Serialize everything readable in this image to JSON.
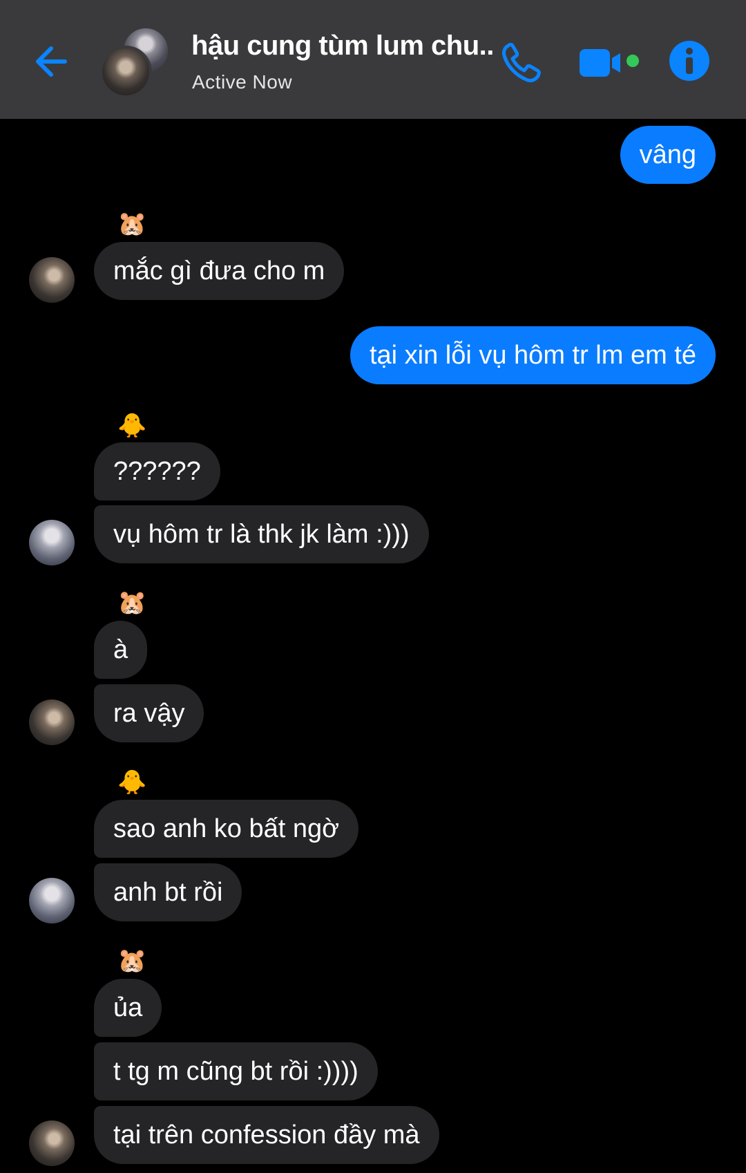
{
  "header": {
    "title": "hậu cung tùm lum chu...",
    "status": "Active Now",
    "colors": {
      "background": "#3a3a3c",
      "accent": "#0a84ff",
      "online_dot": "#34c759"
    },
    "icons": [
      "back-arrow-icon",
      "phone-icon",
      "video-camera-icon",
      "info-icon"
    ]
  },
  "messages": [
    {
      "direction": "outgoing",
      "text": "vâng"
    },
    {
      "direction": "incoming",
      "text": "mắc gì đưa cho m",
      "sender": "hamster"
    },
    {
      "direction": "outgoing",
      "text": "tại xin lỗi vụ hôm tr lm em té"
    },
    {
      "direction": "incoming",
      "text": "??????",
      "sender": "chick"
    },
    {
      "direction": "incoming",
      "text": "vụ hôm tr là thk jk làm :)))",
      "sender": "chick"
    },
    {
      "direction": "incoming",
      "text": "à",
      "sender": "hamster"
    },
    {
      "direction": "incoming",
      "text": "ra vậy",
      "sender": "hamster"
    },
    {
      "direction": "incoming",
      "text": "sao anh ko bất ngờ",
      "sender": "chick"
    },
    {
      "direction": "incoming",
      "text": "anh bt rồi",
      "sender": "chick"
    },
    {
      "direction": "incoming",
      "text": "ủa",
      "sender": "hamster"
    },
    {
      "direction": "incoming",
      "text": "t tg m cũng bt rồi :))))",
      "sender": "hamster"
    },
    {
      "direction": "incoming",
      "text": "tại trên confession đầy mà",
      "sender": "hamster"
    }
  ],
  "sender_labels": {
    "hamster": "🐹",
    "chick": "🐥"
  },
  "colors": {
    "incoming_bubble": "#252527",
    "outgoing_bubble": "#0a7cff",
    "background": "#000000"
  }
}
